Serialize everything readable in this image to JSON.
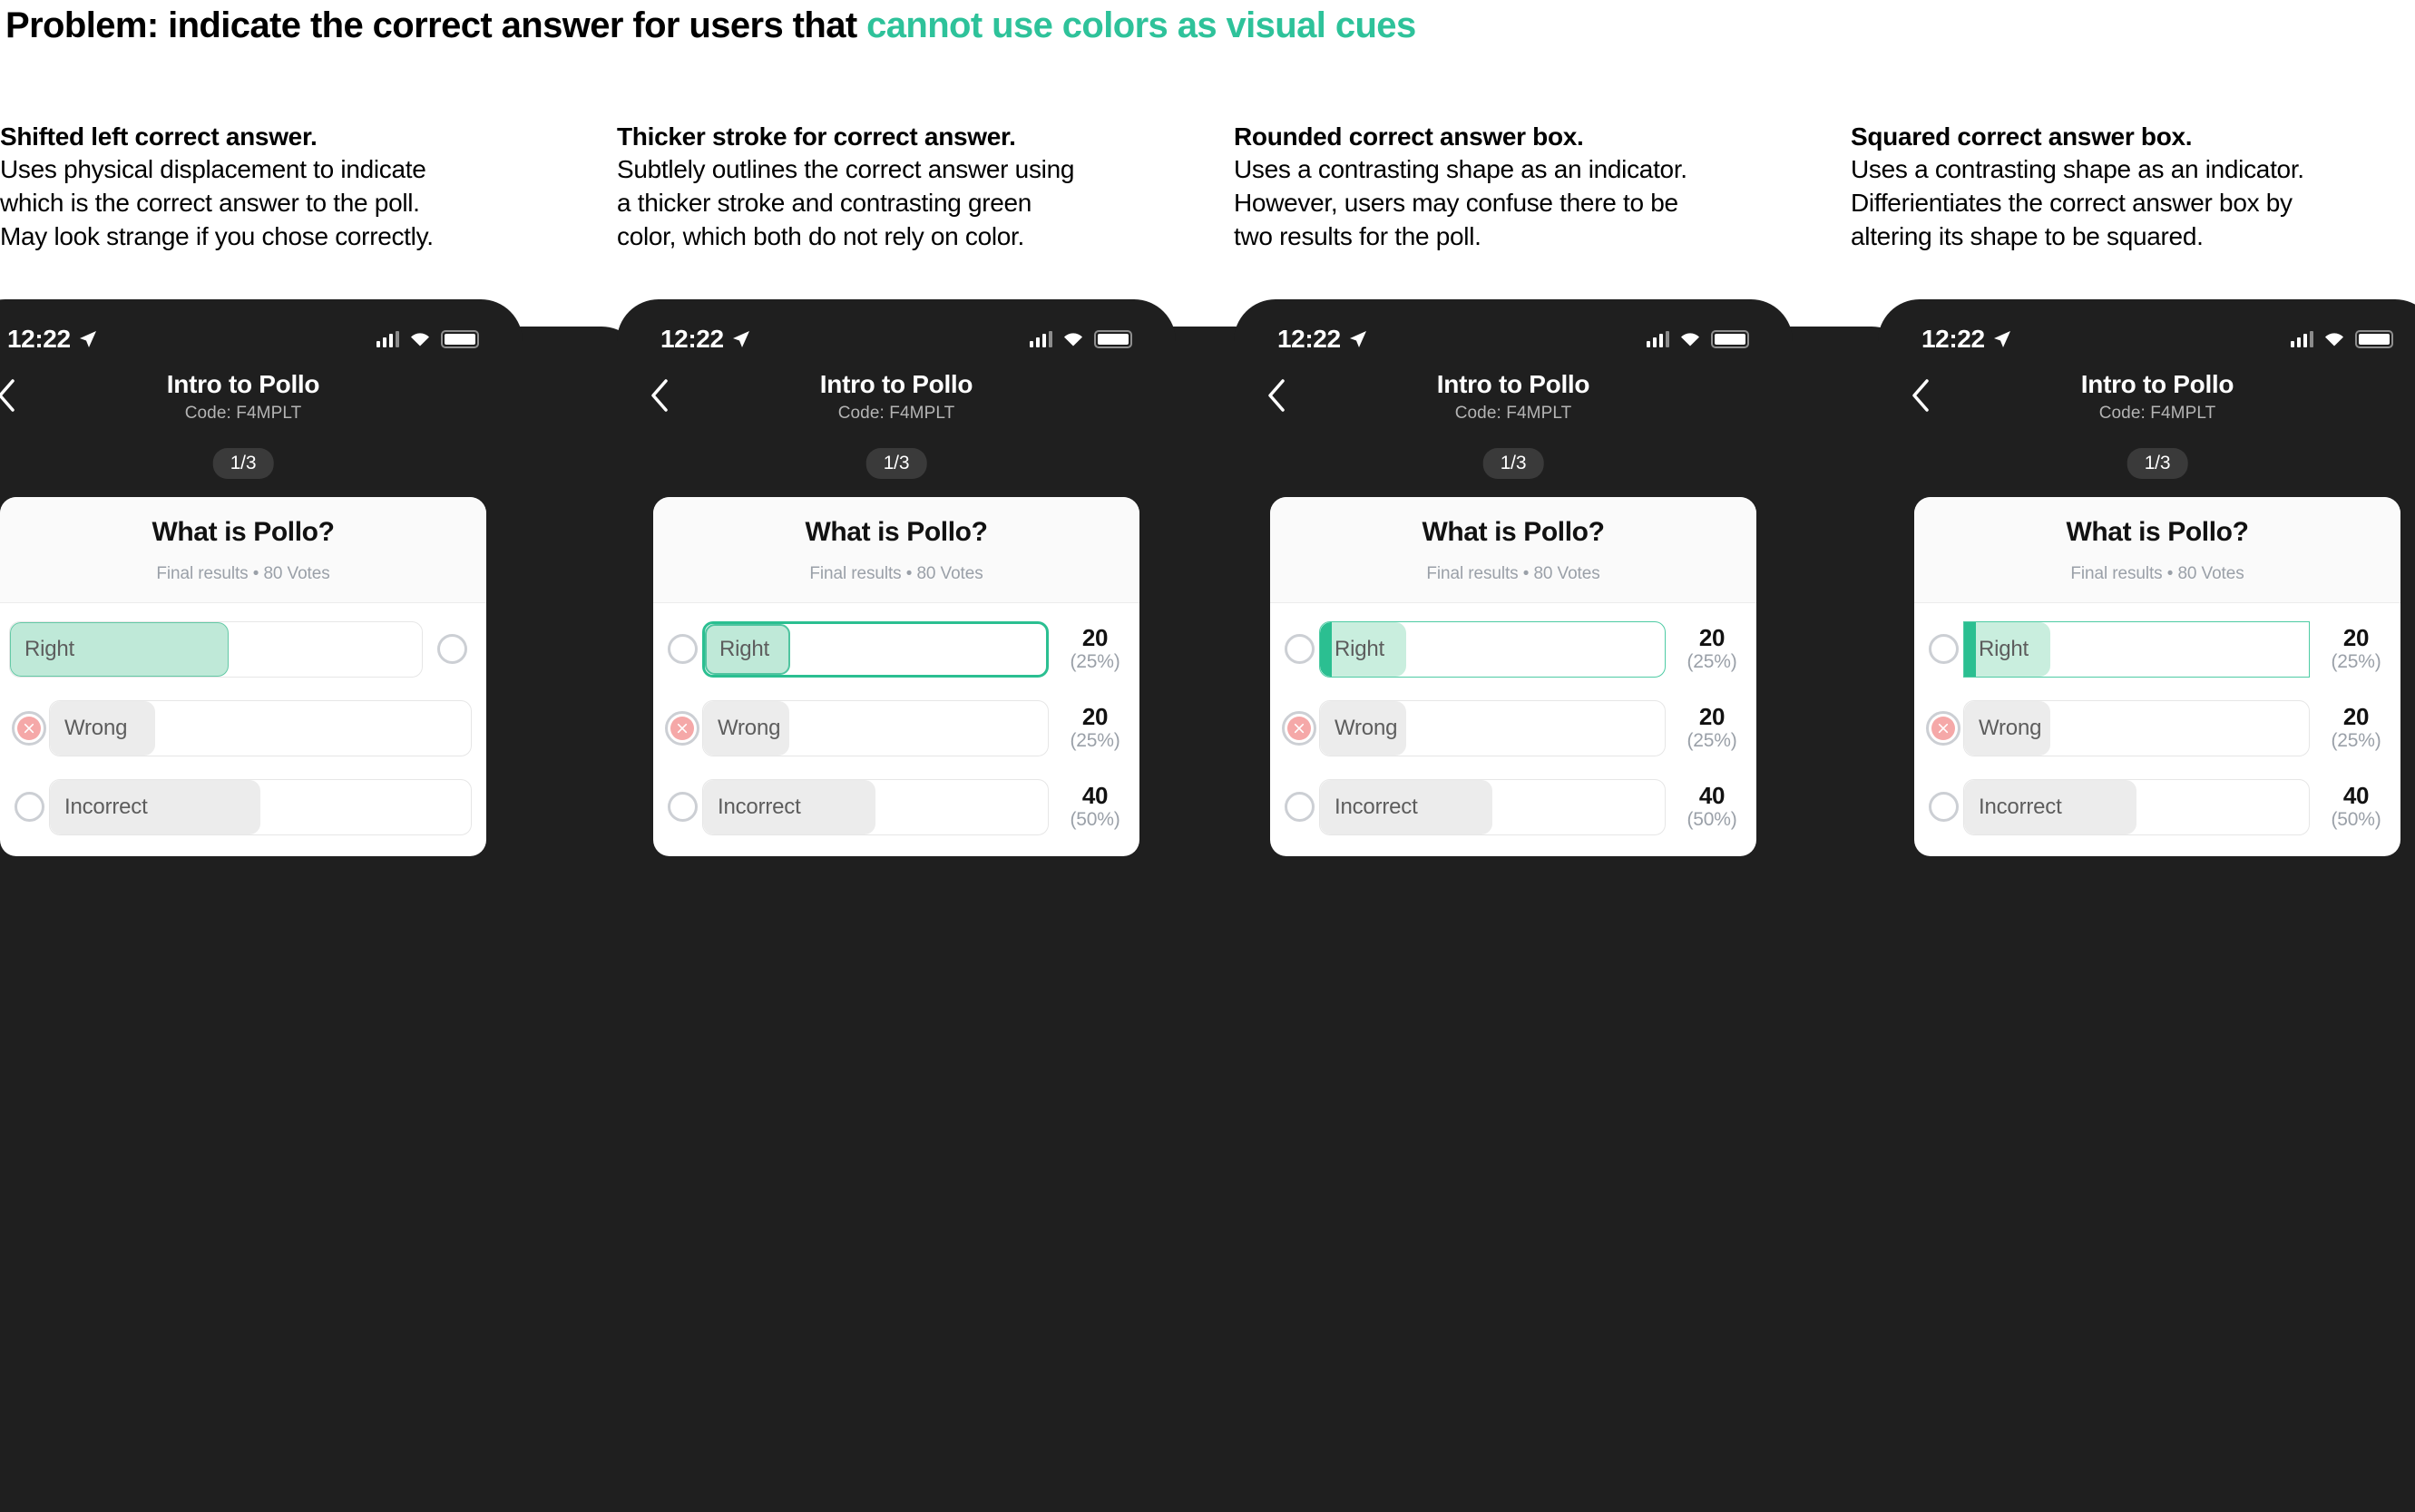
{
  "problem": {
    "prefix": "Problem: indicate the correct answer for users that ",
    "accent": "cannot use colors as visual cues",
    "accent_color": "#2EC29A"
  },
  "colors": {
    "phone_bg": "#1F1F1F",
    "green_stroke": "#2BBF91",
    "green_fill": "#BFE9D8",
    "gray_fill": "#ECECEC",
    "red_x": "#F5A8A8"
  },
  "phone": {
    "status": {
      "time": "12:22",
      "location_icon": "location-arrow-icon",
      "signal_icon": "cellular-signal-icon",
      "wifi_icon": "wifi-icon",
      "battery_icon": "battery-full-icon"
    },
    "nav": {
      "back_icon": "back-chevron-icon",
      "title": "Intro to Pollo",
      "subtitle": "Code: F4MPLT"
    },
    "progress": "1/3",
    "poll": {
      "question": "What is Pollo?",
      "meta": "Final results • 80 Votes"
    }
  },
  "options": [
    {
      "label": "Right",
      "count": "20",
      "percent": "(25%)",
      "fill": 25,
      "state": "correct"
    },
    {
      "label": "Wrong",
      "count": "20",
      "percent": "(25%)",
      "fill": 25,
      "state": "chosen-wrong"
    },
    {
      "label": "Incorrect",
      "count": "40",
      "percent": "(50%)",
      "fill": 50,
      "state": "normal"
    }
  ],
  "columns": [
    {
      "title": "Shifted left correct answer.",
      "desc": "Uses physical displacement to indicate\nwhich is the correct answer to the poll.\nMay look strange if you chose correctly.",
      "variant": "v-shift"
    },
    {
      "title": "Thicker stroke for correct answer.",
      "desc": "Subtlely outlines the correct answer using\na thicker stroke and contrasting green\ncolor, which both do not rely on color.",
      "variant": "v-stroke"
    },
    {
      "title": "Rounded correct answer box.",
      "desc": "Uses a contrasting shape as an indicator.\nHowever, users may confuse there to be\ntwo results for the poll.",
      "variant": "v-round"
    },
    {
      "title": "Squared correct answer box.",
      "desc": "Uses a contrasting shape as an indicator.\nDifferientiates the correct answer box by\naltering its shape to be squared.",
      "variant": "v-square"
    }
  ]
}
